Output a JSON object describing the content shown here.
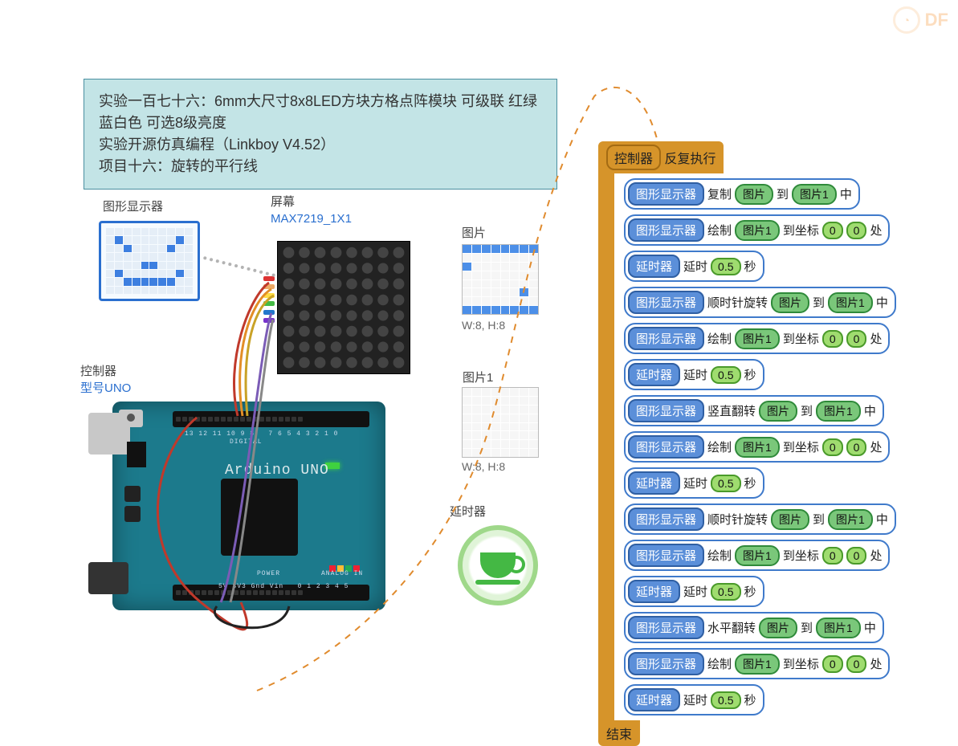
{
  "watermark": "DF",
  "info": {
    "line1": "实验一百七十六：6mm大尺寸8x8LED方块方格点阵模块 可级联 红绿蓝白色 可选8级亮度",
    "line2": "实验开源仿真编程（Linkboy V4.52）",
    "line3": "项目十六：旋转的平行线"
  },
  "labels": {
    "graphicDisplay": "图形显示器",
    "screen": "屏幕",
    "screenModel": "MAX7219_1X1",
    "pic": "图片",
    "pic1": "图片1",
    "controller": "控制器",
    "controllerModel": "型号UNO",
    "timer": "延时器"
  },
  "sprites": {
    "picDim": "W:8, H:8",
    "pic1Dim": "W:8, H:8"
  },
  "arduino": {
    "boardName": "Arduino UNO"
  },
  "program": {
    "header_obj": "控制器",
    "header_action": "反复执行",
    "footer": "结束",
    "tokens": {
      "disp": "图形显示器",
      "timer": "延时器",
      "copy": "复制",
      "draw": "绘制",
      "rotCW": "顺时针旋转",
      "flipV": "竖直翻转",
      "flipH": "水平翻转",
      "delay": "延时",
      "to": "到",
      "toCoord": "到坐标",
      "at": "处",
      "in": "中",
      "sec": "秒",
      "pic": "图片",
      "pic1": "图片1",
      "half": "0.5",
      "zero": "0"
    },
    "lines": [
      {
        "type": "transform",
        "op": "copy"
      },
      {
        "type": "draw"
      },
      {
        "type": "delay"
      },
      {
        "type": "transform",
        "op": "rotCW"
      },
      {
        "type": "draw"
      },
      {
        "type": "delay"
      },
      {
        "type": "transform",
        "op": "flipV"
      },
      {
        "type": "draw"
      },
      {
        "type": "delay"
      },
      {
        "type": "transform",
        "op": "rotCW"
      },
      {
        "type": "draw"
      },
      {
        "type": "delay"
      },
      {
        "type": "transform",
        "op": "flipH"
      },
      {
        "type": "draw"
      },
      {
        "type": "delay"
      }
    ]
  },
  "display_pattern": [
    0,
    0,
    0,
    0,
    0,
    0,
    0,
    0,
    0,
    0,
    0,
    1,
    0,
    0,
    0,
    0,
    0,
    0,
    1,
    0,
    0,
    0,
    1,
    0,
    0,
    0,
    0,
    1,
    0,
    0,
    0,
    0,
    0,
    0,
    0,
    0,
    0,
    0,
    0,
    0,
    0,
    0,
    0,
    0,
    1,
    1,
    0,
    0,
    0,
    0,
    0,
    1,
    0,
    0,
    0,
    0,
    0,
    0,
    1,
    0,
    0,
    0,
    1,
    1,
    1,
    1,
    1,
    1,
    0,
    0,
    0,
    0,
    0,
    0,
    0,
    0,
    0,
    0,
    0,
    0
  ],
  "pic_pattern": [
    1,
    1,
    1,
    1,
    1,
    1,
    1,
    1,
    0,
    0,
    0,
    0,
    0,
    0,
    0,
    0,
    1,
    0,
    0,
    0,
    0,
    0,
    0,
    0,
    0,
    0,
    0,
    0,
    0,
    0,
    0,
    0,
    0,
    0,
    0,
    0,
    0,
    0,
    0,
    0,
    0,
    0,
    0,
    0,
    0,
    0,
    1,
    0,
    0,
    0,
    0,
    0,
    0,
    0,
    0,
    0,
    1,
    1,
    1,
    1,
    1,
    1,
    1,
    1
  ]
}
